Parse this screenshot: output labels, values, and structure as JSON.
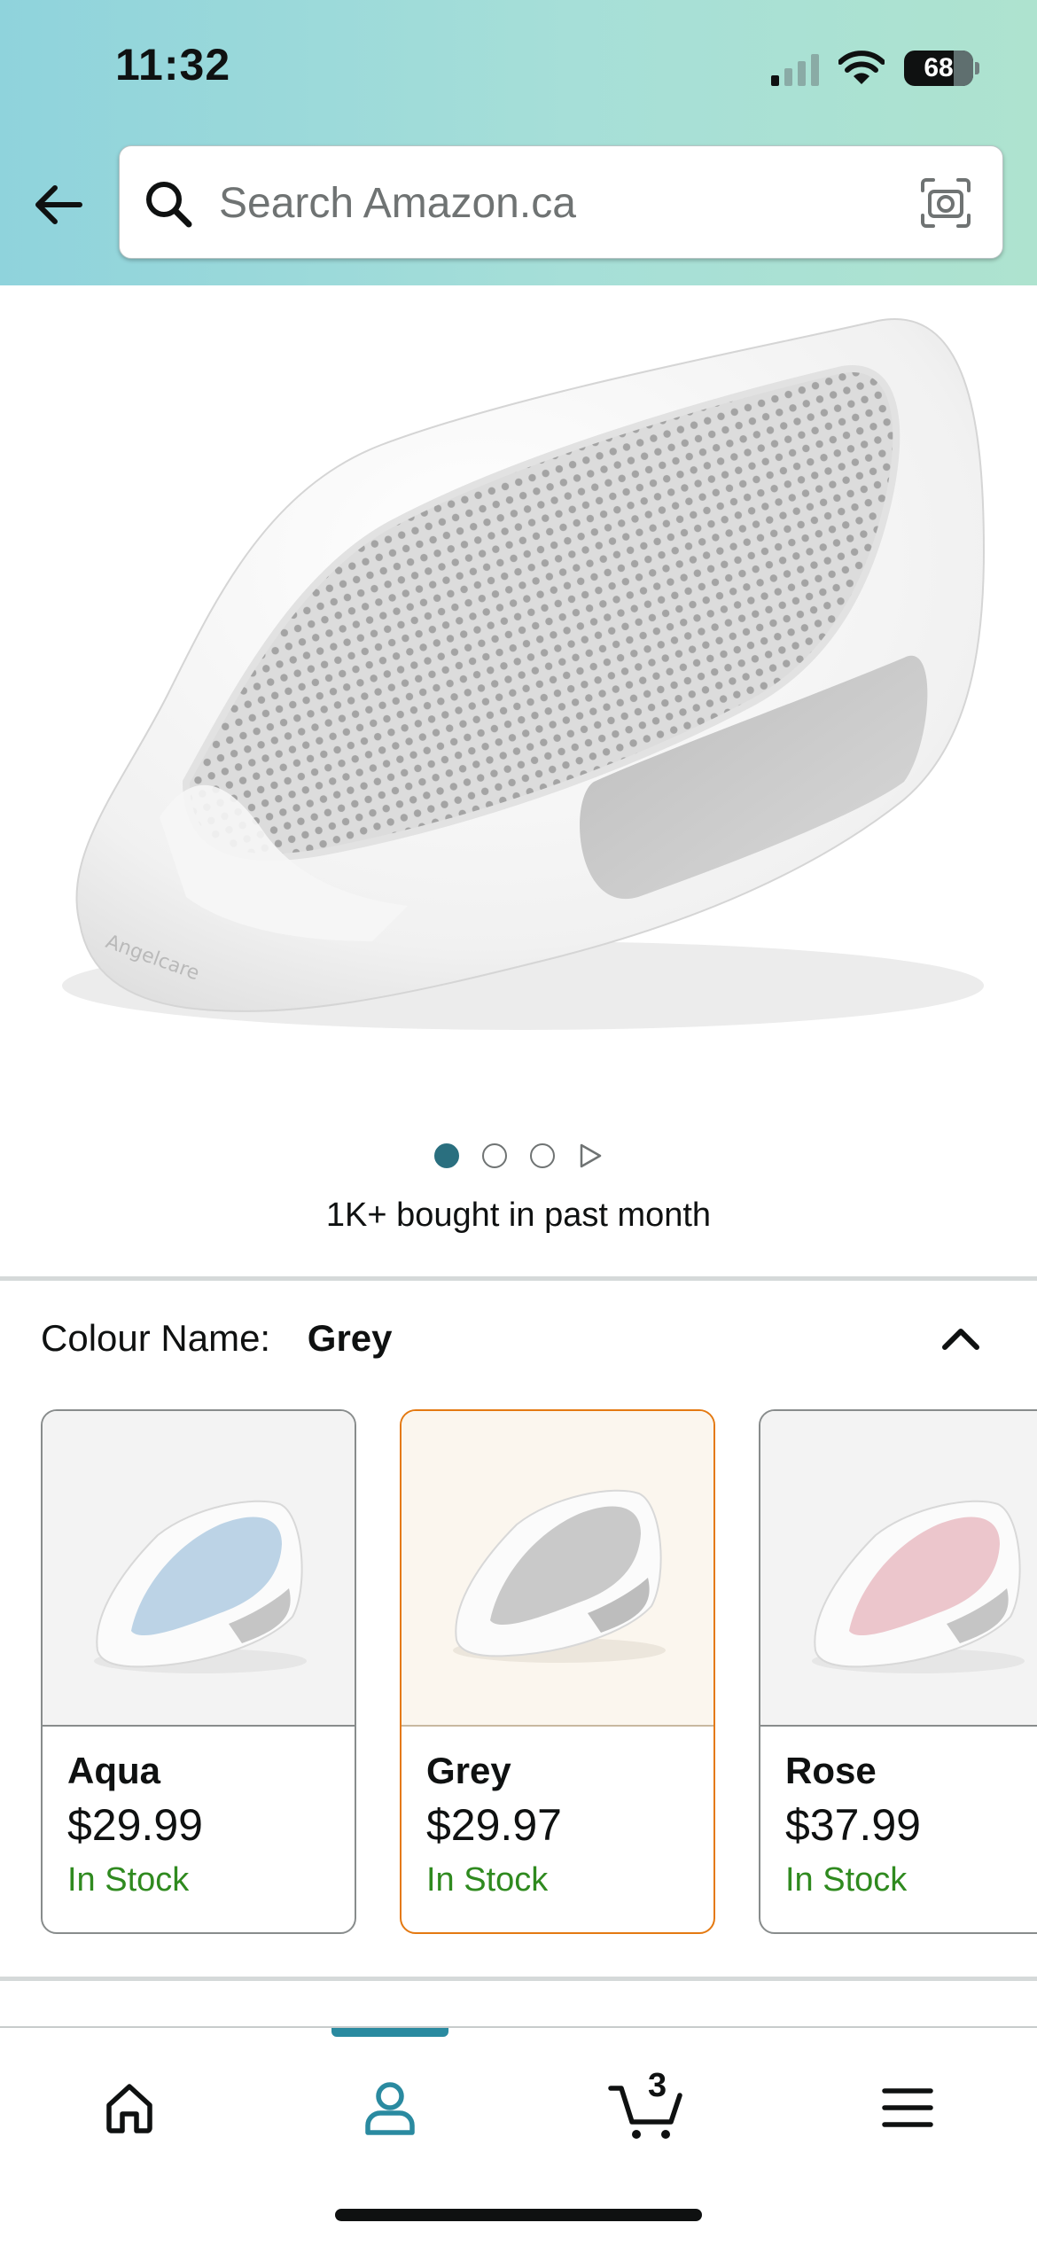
{
  "status_bar": {
    "time": "11:32",
    "battery": "68"
  },
  "search": {
    "placeholder": "Search Amazon.ca"
  },
  "product": {
    "image_alt": "Angelcare bath support, grey",
    "brand_mark": "Angelcare",
    "carousel": {
      "total_images": 3,
      "active_index": 0,
      "has_video": true
    },
    "bought_text": "1K+ bought in past month"
  },
  "colour": {
    "label": "Colour Name:",
    "selected": "Grey",
    "options": [
      {
        "name": "Aqua",
        "price": "$29.99",
        "stock": "In Stock",
        "tint": "#bcd3e6"
      },
      {
        "name": "Grey",
        "price": "$29.97",
        "stock": "In Stock",
        "tint": "#c9c9c9"
      },
      {
        "name": "Rose",
        "price": "$37.99",
        "stock": "In Stock",
        "tint": "#ecc6cc"
      }
    ]
  },
  "bottom_nav": {
    "items": [
      {
        "id": "home",
        "icon": "home-icon"
      },
      {
        "id": "account",
        "icon": "person-icon",
        "active": true
      },
      {
        "id": "cart",
        "icon": "cart-icon",
        "count": "3"
      },
      {
        "id": "menu",
        "icon": "menu-icon"
      }
    ]
  },
  "colors": {
    "accent": "#2a8aa0",
    "selected_border": "#e47911",
    "in_stock": "#2f8a1f"
  }
}
